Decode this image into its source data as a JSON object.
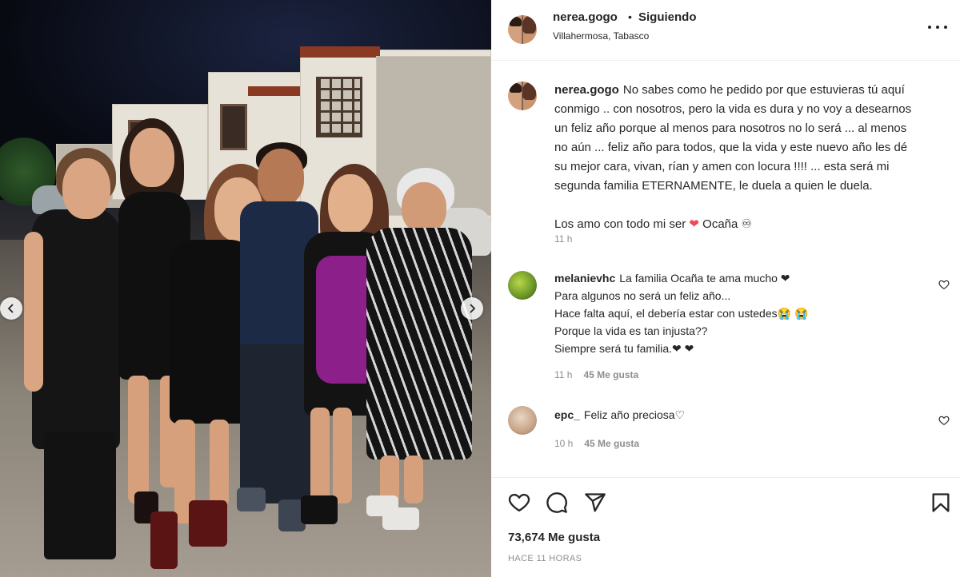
{
  "post": {
    "author": "nerea.gogo",
    "separator": "•",
    "follow_state": "Siguiendo",
    "location": "Villahermosa, Tabasco",
    "caption_lines": [
      "No sabes como he pedido por que estuvieras tú aquí",
      "conmigo .. con nosotros, pero la vida es dura y no voy a desearnos",
      "un feliz año porque al menos para nosotros no lo será ... al menos",
      "no aún ... feliz año para todos, que la vida y este nuevo año les dé",
      "su mejor cara, vivan, rían y amen con locura !!!! ... esta será mi",
      "segunda familia ETERNAMENTE, le duela a quien le duela."
    ],
    "caption_closing": "Los amo con todo mi ser",
    "caption_closing_emoji": "❤",
    "caption_closing_end": "Ocaña ♾",
    "caption_time": "11 h",
    "likes": "73,674 Me gusta",
    "time_ago": "HACE 11 HORAS"
  },
  "comments": [
    {
      "username": "melanievhc",
      "lines": [
        "La familia Ocaña te ama mucho ❤",
        "Para algunos no será un feliz año...",
        "Hace falta aquí, el debería estar con ustedes😭 😭",
        "Porque la vida es tan injusta??",
        "Siempre será tu familia.❤ ❤"
      ],
      "time": "11 h",
      "likes": "45 Me gusta"
    },
    {
      "username": "epc_",
      "lines": [
        "Feliz año preciosa♡"
      ],
      "time": "10 h",
      "likes": "45 Me gusta"
    }
  ],
  "icons": {
    "more": "more-options-icon",
    "like": "heart-icon",
    "comment": "comment-bubble-icon",
    "share": "paper-plane-icon",
    "save": "bookmark-icon",
    "prev": "chevron-left-icon",
    "next": "chevron-right-icon"
  },
  "colors": {
    "text": "#262626",
    "muted": "#8e8e8e",
    "heart": "#ed4956",
    "divider": "#efefef"
  }
}
